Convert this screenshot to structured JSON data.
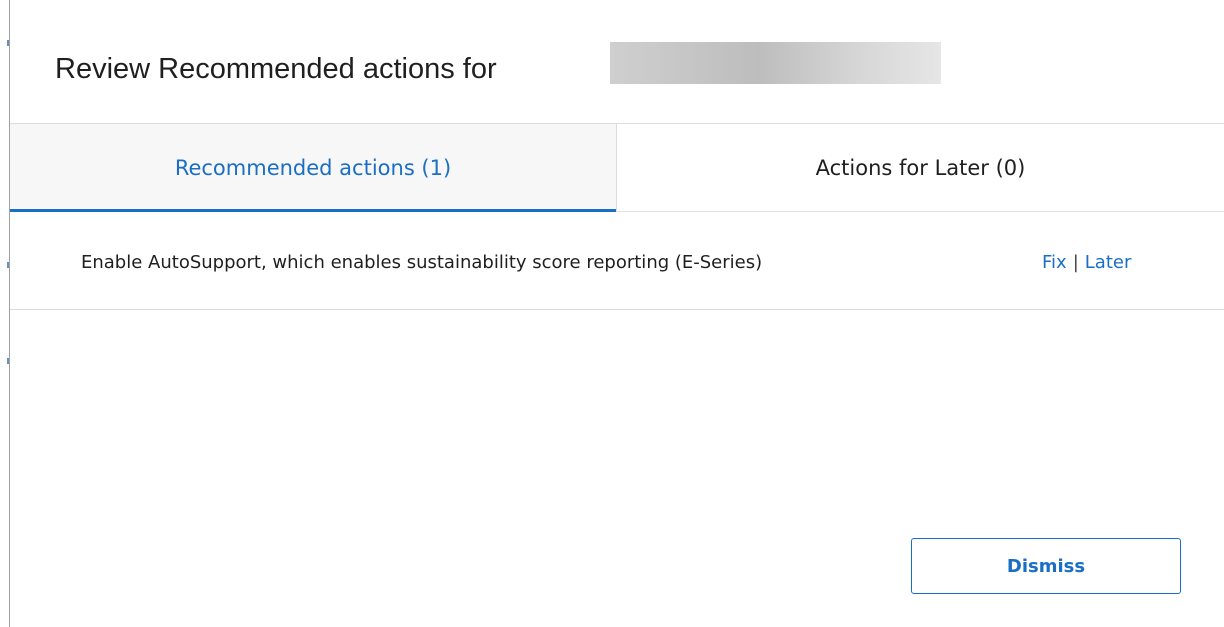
{
  "dialog": {
    "title": "Review Recommended actions for"
  },
  "tabs": [
    {
      "label": "Recommended actions (1)",
      "active": true
    },
    {
      "label": "Actions for Later (0)",
      "active": false
    }
  ],
  "actions": [
    {
      "text": "Enable AutoSupport, which enables sustainability score reporting (E-Series)",
      "fix_label": "Fix",
      "separator": "|",
      "later_label": "Later"
    }
  ],
  "footer": {
    "dismiss_label": "Dismiss"
  },
  "colors": {
    "accent": "#1a6fc4",
    "text": "#1f1f1f",
    "divider": "#dcdcdc"
  }
}
